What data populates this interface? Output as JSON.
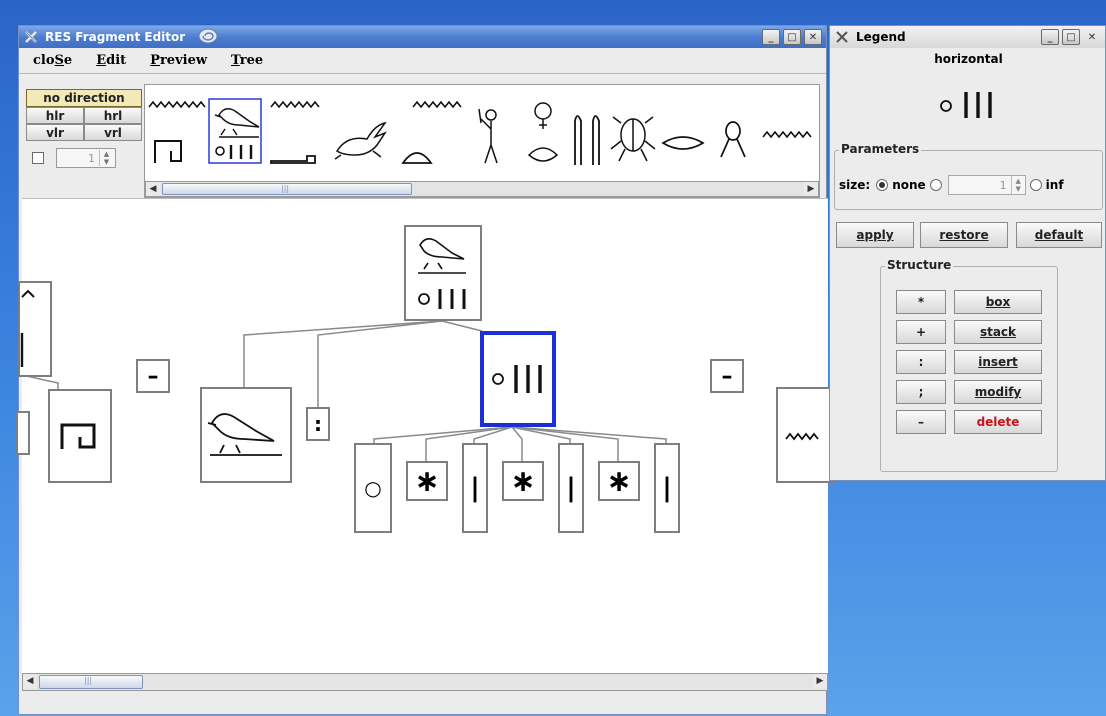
{
  "editor": {
    "title": "RES Fragment Editor",
    "menu": [
      {
        "label": "cloSe"
      },
      {
        "label": "Edit"
      },
      {
        "label": "Preview"
      },
      {
        "label": "Tree"
      }
    ],
    "directions": {
      "no_direction": "no direction",
      "hlr": "hlr",
      "hrl": "hrl",
      "vlr": "vlr",
      "vrl": "vrl"
    },
    "size_value": "1",
    "separators": {
      "left": "–",
      "right": "–",
      "colon": ":"
    },
    "tree_children": {
      "circle": "○",
      "star": "∗",
      "bar": "|"
    }
  },
  "legend": {
    "title": "Legend",
    "mode": "horizontal",
    "preview_glyph": "○ ∣∣∣",
    "parameters_label": "Parameters",
    "size_label": "size:",
    "none_label": "none",
    "inf_label": "inf",
    "size_value": "1",
    "size_selected": "none",
    "buttons": {
      "apply": "apply",
      "restore": "restore",
      "default": "default"
    },
    "structure_label": "Structure",
    "structure_rows": [
      {
        "op": "*",
        "label": "box"
      },
      {
        "op": "+",
        "label": "stack"
      },
      {
        "op": ":",
        "label": "insert"
      },
      {
        "op": ";",
        "label": "modify"
      },
      {
        "op": "–",
        "label": "delete"
      }
    ]
  },
  "colors": {
    "accent_selection": "#1a2fd6",
    "delete_text": "#c8141e",
    "titlebar": "#4d7ed0"
  }
}
